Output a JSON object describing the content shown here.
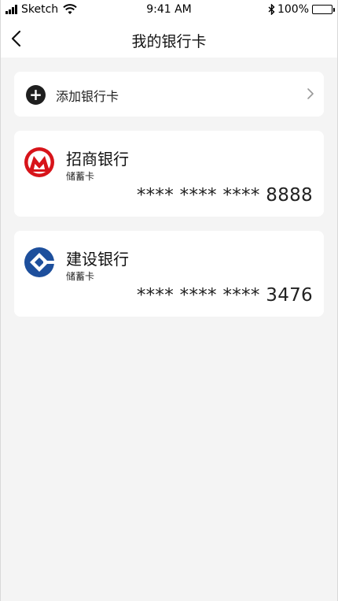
{
  "status_bar": {
    "carrier": "Sketch",
    "time": "9:41 AM",
    "bluetooth": "✱",
    "battery": "100%",
    "icons": [
      "signal-icon",
      "wifi-icon",
      "bluetooth-icon",
      "battery-icon"
    ]
  },
  "nav": {
    "title": "我的银行卡",
    "back_icon": "chevron-left-icon"
  },
  "add_card": {
    "label": "添加银行卡",
    "plus": "+",
    "icon": "plus-circle-icon",
    "chevron_icon": "chevron-right-icon"
  },
  "cards": [
    {
      "bank": "招商银行",
      "type": "储蓄卡",
      "number": "**** **** **** 8888",
      "logo_icon": "cmb-logo-icon",
      "color": "#d7141a"
    },
    {
      "bank": "建设银行",
      "type": "储蓄卡",
      "number": "**** **** **** 3476",
      "logo_icon": "ccb-logo-icon",
      "color": "#1d4f9c"
    }
  ]
}
